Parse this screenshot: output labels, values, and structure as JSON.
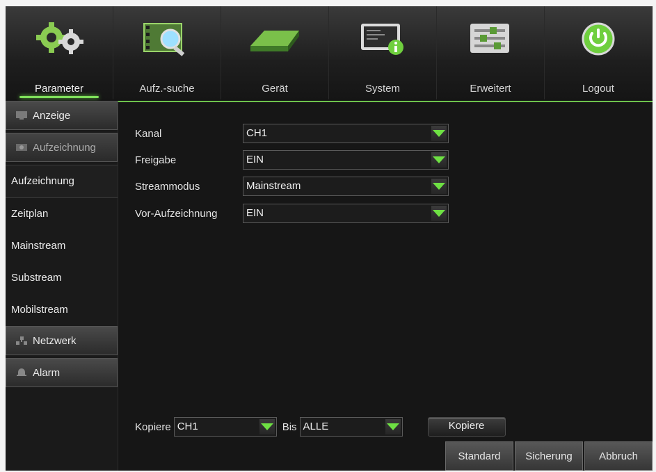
{
  "topnav": {
    "tabs": [
      {
        "label": "Parameter",
        "icon": "gears-icon",
        "active": true
      },
      {
        "label": "Aufz.-suche",
        "icon": "film-search-icon"
      },
      {
        "label": "Gerät",
        "icon": "hard-drive-icon"
      },
      {
        "label": "System",
        "icon": "monitor-info-icon"
      },
      {
        "label": "Erweitert",
        "icon": "sliders-icon"
      },
      {
        "label": "Logout",
        "icon": "power-icon"
      }
    ]
  },
  "sidebar": {
    "sections": {
      "anzeige": "Anzeige",
      "aufzeichnung": "Aufzeichnung",
      "netzwerk": "Netzwerk",
      "alarm": "Alarm"
    },
    "items": [
      "Aufzeichnung",
      "Zeitplan",
      "Mainstream",
      "Substream",
      "Mobilstream"
    ]
  },
  "form": {
    "kanal": {
      "label": "Kanal",
      "value": "CH1"
    },
    "freigabe": {
      "label": "Freigabe",
      "value": "EIN"
    },
    "streammodus": {
      "label": "Streammodus",
      "value": "Mainstream"
    },
    "vor_aufzeichnung": {
      "label": "Vor-Aufzeichnung",
      "value": "EIN"
    }
  },
  "copy": {
    "label": "Kopiere",
    "from_value": "CH1",
    "to_label": "Bis",
    "to_value": "ALLE",
    "button": "Kopiere"
  },
  "buttons": {
    "standard": "Standard",
    "sicherung": "Sicherung",
    "abbruch": "Abbruch"
  },
  "colors": {
    "accent": "#6ee043",
    "background": "#141414"
  }
}
